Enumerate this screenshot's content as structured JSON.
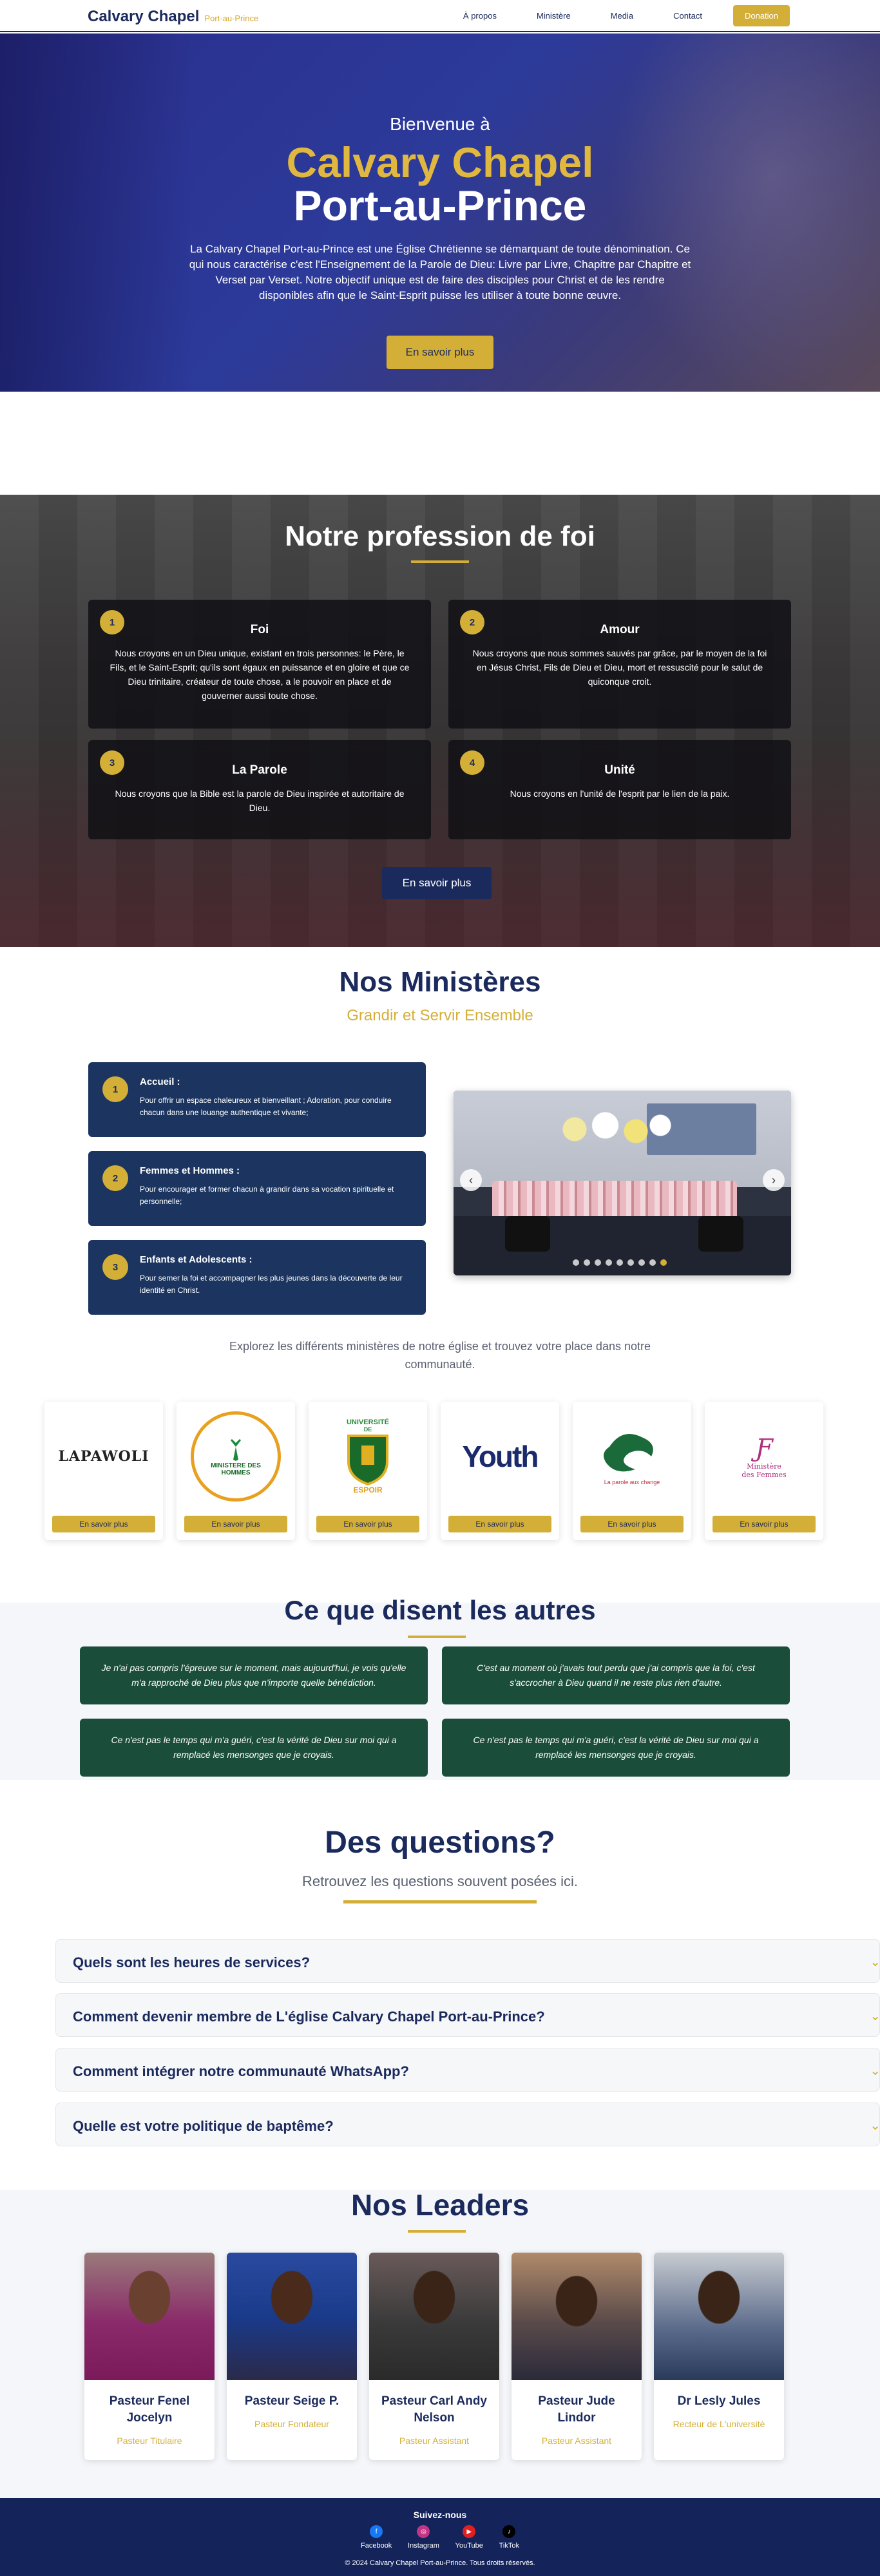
{
  "nav": {
    "brand": "Calvary Chapel",
    "brand_sub": "Port-au-Prince",
    "links": [
      "À propos",
      "Ministère",
      "Media",
      "Contact"
    ],
    "donation": "Donation"
  },
  "hero": {
    "welcome": "Bienvenue à",
    "title1": "Calvary Chapel",
    "title2": "Port-au-Prince",
    "text": "La Calvary Chapel Port-au-Prince est une Église Chrétienne se démarquant de toute dénomination. Ce qui nous caractérise c'est l'Enseignement de la Parole de Dieu: Livre par Livre, Chapitre par Chapitre et Verset par Verset. Notre objectif unique est de faire des disciples pour Christ et de les rendre disponibles afin que le Saint-Esprit puisse les utiliser à toute bonne œuvre.",
    "button": "En savoir plus"
  },
  "faith": {
    "title": "Notre profession de foi",
    "cards": [
      {
        "num": "1",
        "title": "Foi",
        "text": "Nous croyons en un Dieu unique, existant en trois personnes: le Père, le Fils, et le Saint-Esprit; qu'ils sont égaux en puissance et en gloire et que ce Dieu trinitaire, créateur de toute chose, a le pouvoir en place et de gouverner aussi toute chose."
      },
      {
        "num": "2",
        "title": "Amour",
        "text": "Nous croyons que nous sommes sauvés par grâce, par le moyen de la foi en Jésus Christ, Fils de Dieu et Dieu, mort et ressuscité pour le salut de quiconque croit."
      },
      {
        "num": "3",
        "title": "La Parole",
        "text": "Nous croyons que la Bible est la parole de Dieu inspirée et autoritaire de Dieu."
      },
      {
        "num": "4",
        "title": "Unité",
        "text": "Nous croyons en l'unité de l'esprit par le lien de la paix."
      }
    ],
    "button": "En savoir plus"
  },
  "ministries": {
    "title": "Nos Ministères",
    "subtitle": "Grandir et Servir Ensemble",
    "items": [
      {
        "num": "1",
        "title": "Accueil :",
        "text": "Pour offrir un espace chaleureux et bienveillant ; Adoration, pour conduire chacun dans une louange authentique et vivante;"
      },
      {
        "num": "2",
        "title": "Femmes et Hommes :",
        "text": "Pour encourager et former chacun à grandir dans sa vocation spirituelle et personnelle;"
      },
      {
        "num": "3",
        "title": "Enfants et Adolescents :",
        "text": "Pour semer la foi et accompagner les plus jeunes dans la découverte de leur identité en Christ."
      }
    ],
    "slider_prev": "‹",
    "slider_next": "›",
    "explore": "Explorez les différents ministères de notre église et trouvez votre place dans notre communauté.",
    "logos": [
      {
        "name": "LAPAWOLI",
        "button": "En savoir plus"
      },
      {
        "name": "MINISTERE DES HOMMES",
        "button": "En savoir plus"
      },
      {
        "name": "UNIVERSITE DE L'ESPOIR",
        "top": "UNIVERSITÉ",
        "mid": "DE",
        "bottom": "ESPOIR",
        "button": "En savoir plus"
      },
      {
        "name": "Youth",
        "button": "En savoir plus"
      },
      {
        "name": "La parole aux change",
        "button": "En savoir plus"
      },
      {
        "name": "Ministère des Femmes",
        "line1": "Ministère",
        "line2": "des Femmes",
        "button": "En savoir plus"
      }
    ]
  },
  "testimonials": {
    "title": "Ce que disent les autres",
    "items": [
      "Je n'ai pas compris l'épreuve sur le moment, mais aujourd'hui, je vois qu'elle m'a rapproché de Dieu plus que n'importe quelle bénédiction.",
      "C'est au moment où j'avais tout perdu que j'ai compris que la foi, c'est s'accrocher à Dieu quand il ne reste plus rien d'autre.",
      "Ce n'est pas le temps qui m'a guéri, c'est la vérité de Dieu sur moi qui a remplacé les mensonges que je croyais.",
      "Ce n'est pas le temps qui m'a guéri, c'est la vérité de Dieu sur moi qui a remplacé les mensonges que je croyais."
    ]
  },
  "faq": {
    "title": "Des questions?",
    "subtitle": "Retrouvez les questions souvent posées ici.",
    "items": [
      "Quels sont les heures de services?",
      "Comment devenir membre de L'église Calvary Chapel Port-au-Prince?",
      "Comment intégrer notre communauté WhatsApp?",
      "Quelle est votre politique de baptême?"
    ]
  },
  "leaders": {
    "title": "Nos Leaders",
    "items": [
      {
        "name": "Pasteur Fenel Jocelyn",
        "role": "Pasteur Titulaire"
      },
      {
        "name": "Pasteur Seige P.",
        "role": "Pasteur Fondateur"
      },
      {
        "name": "Pasteur Carl Andy Nelson",
        "role": "Pasteur Assistant"
      },
      {
        "name": "Pasteur Jude Lindor",
        "role": "Pasteur Assistant"
      },
      {
        "name": "Dr Lesly Jules",
        "role": "Recteur de L'université"
      }
    ]
  },
  "footer": {
    "title": "Suivez-nous",
    "socials": [
      "Facebook",
      "Instagram",
      "YouTube",
      "TikTok"
    ],
    "copyright": "© 2024 Calvary Chapel Port-au-Prince. Tous droits réservés."
  }
}
